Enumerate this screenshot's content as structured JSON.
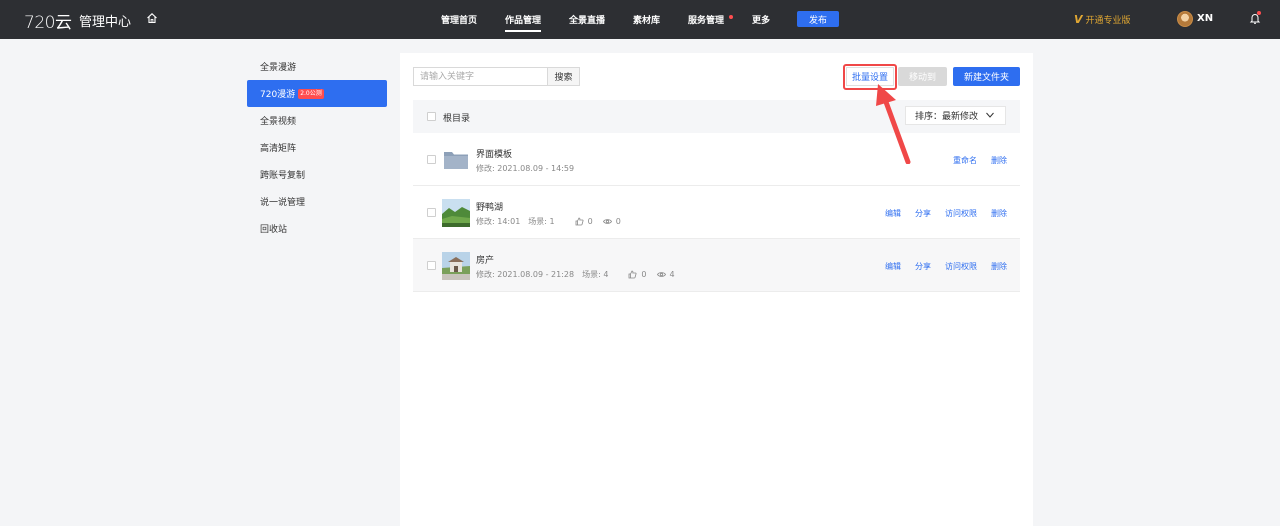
{
  "header": {
    "logo": "720云",
    "center_title": "管理中心",
    "nav": [
      {
        "label": "管理首页"
      },
      {
        "label": "作品管理",
        "active": true
      },
      {
        "label": "全景直播"
      },
      {
        "label": "素材库"
      },
      {
        "label": "服务管理"
      },
      {
        "label": "更多"
      }
    ],
    "publish_label": "发布",
    "pro_label": "开通专业版",
    "pro_mark": "V",
    "username": "XN"
  },
  "sidebar": {
    "items": [
      {
        "label": "全景漫游"
      },
      {
        "label": "720漫游",
        "badge": "2.0公测",
        "active": true
      },
      {
        "label": "全景视频"
      },
      {
        "label": "高清矩阵"
      },
      {
        "label": "跨账号复制"
      },
      {
        "label": "说一说管理"
      },
      {
        "label": "回收站"
      }
    ]
  },
  "toolbar": {
    "search_placeholder": "请输入关键字",
    "search_label": "搜索",
    "batch_label": "批量设置",
    "move_label": "移动到",
    "new_folder_label": "新建文件夹"
  },
  "list": {
    "root_label": "根目录",
    "sort_label": "排序：最新修改",
    "rows": [
      {
        "title": "界面模板",
        "meta": "修改: 2021.08.09 - 14:59",
        "actions": [
          "重命名",
          "删除"
        ]
      },
      {
        "title": "野鸭湖",
        "meta": "修改: 14:01",
        "scenes": "场景: 1",
        "likes": "0",
        "views": "0",
        "actions": [
          "编辑",
          "分享",
          "访问权限",
          "删除"
        ]
      },
      {
        "title": "房产",
        "meta": "修改: 2021.08.09 - 21:28",
        "scenes": "场景: 4",
        "likes": "0",
        "views": "4",
        "actions": [
          "编辑",
          "分享",
          "访问权限",
          "删除"
        ]
      }
    ]
  },
  "colors": {
    "accent": "#2e6ef0",
    "topbar": "#2d2f33",
    "highlight": "#f04848",
    "pro": "#e0a733"
  }
}
